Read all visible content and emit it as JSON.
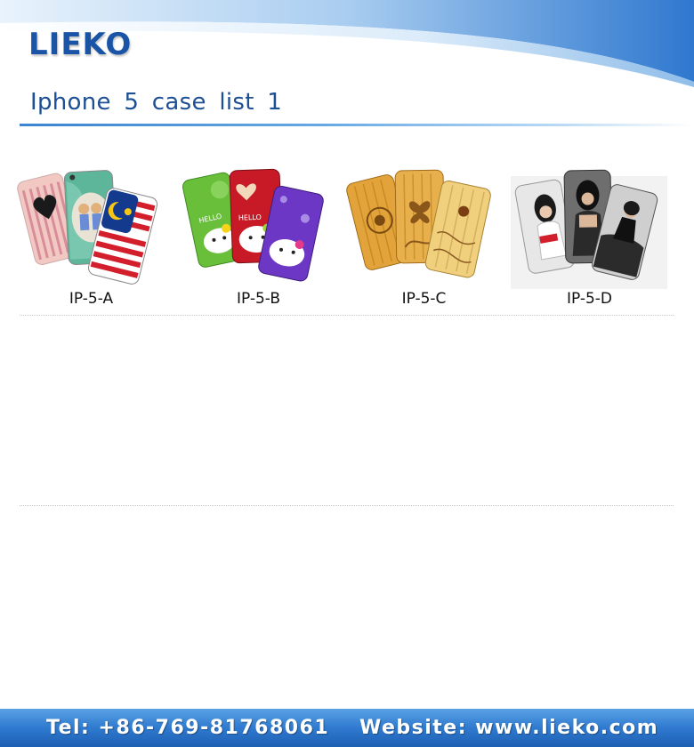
{
  "header": {
    "logo": "LIEKO",
    "title": "Iphone 5  case list 1"
  },
  "products": [
    {
      "code": "IP-5-A",
      "designs": [
        "heart-pattern-case-icon",
        "couple-cartoon-case-icon",
        "malaysia-flag-case-icon"
      ]
    },
    {
      "code": "IP-5-B",
      "designs": [
        "hello-kitty-green-case-icon",
        "hello-kitty-red-case-icon",
        "hello-kitty-purple-case-icon"
      ]
    },
    {
      "code": "IP-5-C",
      "designs": [
        "bamboo-flower-case-icon",
        "bamboo-butterfly-case-icon",
        "bamboo-apple-case-icon"
      ]
    },
    {
      "code": "IP-5-D",
      "designs": [
        "photo-girl-white-case-icon",
        "photo-girl-dark-case-icon",
        "photo-girl-car-case-icon"
      ]
    }
  ],
  "footer": {
    "tel": "Tel: +86-769-81768061",
    "website": "Website: www.lieko.com"
  },
  "colors": {
    "brand_blue": "#1a54a6",
    "title_blue": "#1d4f94",
    "footer_blue": "#2f7ad0"
  }
}
